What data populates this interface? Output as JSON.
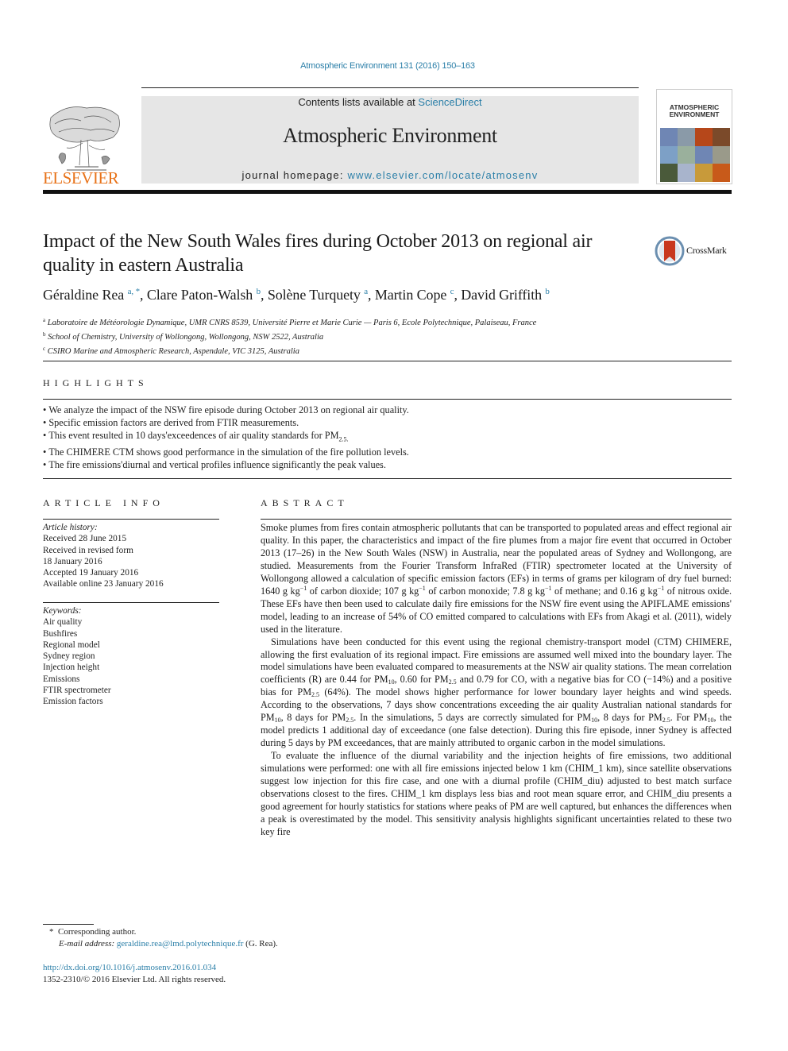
{
  "header": {
    "journal_ref": "Atmospheric Environment 131 (2016) 150–163",
    "contents_prefix": "Contents lists available at ",
    "contents_link": "ScienceDirect",
    "journal_title": "Atmospheric Environment",
    "homepage_prefix": "journal homepage: ",
    "homepage_link": "www.elsevier.com/locate/atmosenv",
    "publisher_logo": "ELSEVIER",
    "cover_title_line1": "ATMOSPHERIC",
    "cover_title_line2": "ENVIRONMENT",
    "colors": {
      "link": "#2b7fa8",
      "publisher": "#e8731a",
      "header_box": "#e6e6e6"
    }
  },
  "article": {
    "title": "Impact of the New South Wales fires during October 2013 on regional air quality in eastern Australia",
    "crossmark_label": "CrossMark",
    "authors": [
      {
        "name": "Géraldine Rea",
        "sup": "a, *"
      },
      {
        "name": "Clare Paton-Walsh",
        "sup": "b"
      },
      {
        "name": "Solène Turquety",
        "sup": "a"
      },
      {
        "name": "Martin Cope",
        "sup": "c"
      },
      {
        "name": "David Griffith",
        "sup": "b"
      }
    ],
    "affiliations": [
      {
        "key": "a",
        "text": "Laboratoire de Météorologie Dynamique, UMR CNRS 8539, Université Pierre et Marie Curie — Paris 6, Ecole Polytechnique, Palaiseau, France"
      },
      {
        "key": "b",
        "text": "School of Chemistry, University of Wollongong, Wollongong, NSW 2522, Australia"
      },
      {
        "key": "c",
        "text": "CSIRO Marine and Atmospheric Research, Aspendale, VIC 3125, Australia"
      }
    ]
  },
  "highlights": {
    "heading": "HIGHLIGHTS",
    "items": [
      "We analyze the impact of the NSW fire episode during October 2013 on regional air quality.",
      "Specific emission factors are derived from FTIR measurements.",
      "This event resulted in 10 days'exceedences of air quality standards for PM",
      "The CHIMERE CTM shows good performance in the simulation of the fire pollution levels.",
      "The fire emissions'diurnal and vertical profiles influence significantly the peak values."
    ],
    "item3_sub": "2.5."
  },
  "article_info": {
    "heading": "ARTICLE INFO",
    "history_label": "Article history:",
    "history": [
      "Received 28 June 2015",
      "Received in revised form",
      "18 January 2016",
      "Accepted 19 January 2016",
      "Available online 23 January 2016"
    ],
    "keywords_label": "Keywords:",
    "keywords": [
      "Air quality",
      "Bushfires",
      "Regional model",
      "Sydney region",
      "Injection height",
      "Emissions",
      "FTIR spectrometer",
      "Emission factors"
    ]
  },
  "abstract": {
    "heading": "ABSTRACT",
    "p1": "Smoke plumes from fires contain atmospheric pollutants that can be transported to populated areas and effect regional air quality. In this paper, the characteristics and impact of the fire plumes from a major fire event that occurred in October 2013 (17–26) in the New South Wales (NSW) in Australia, near the populated areas of Sydney and Wollongong, are studied. Measurements from the Fourier Transform InfraRed (FTIR) spectrometer located at the University of Wollongong allowed a calculation of specific emission factors (EFs) in terms of grams per kilogram of dry fuel burned: 1640 g kg{-1} of carbon dioxide; 107 g kg{-1} of carbon monoxide; 7.8 g kg{-1} of methane; and 0.16 g kg{-1} of nitrous oxide. These EFs have then been used to calculate daily fire emissions for the NSW fire event using the APIFLAME emissions' model, leading to an increase of 54% of CO emitted compared to calculations with EFs from Akagi et al. (2011), widely used in the literature.",
    "p2": "Simulations have been conducted for this event using the regional chemistry-transport model (CTM) CHIMERE, allowing the first evaluation of its regional impact. Fire emissions are assumed well mixed into the boundary layer. The model simulations have been evaluated compared to measurements at the NSW air quality stations. The mean correlation coefficients (R) are 0.44 for PM[10], 0.60 for PM[2.5] and 0.79 for CO, with a negative bias for CO (−14%) and a positive bias for PM[2.5] (64%). The model shows higher performance for lower boundary layer heights and wind speeds. According to the observations, 7 days show concentrations exceeding the air quality Australian national standards for PM[10], 8 days for PM[2.5]. In the simulations, 5 days are correctly simulated for PM[10], 8 days for PM[2.5]. For PM[10], the model predicts 1 additional day of exceedance (one false detection). During this fire episode, inner Sydney is affected during 5 days by PM exceedances, that are mainly attributed to organic carbon in the model simulations.",
    "p3": "To evaluate the influence of the diurnal variability and the injection heights of fire emissions, two additional simulations were performed: one with all fire emissions injected below 1 km (CHIM_1 km), since satellite observations suggest low injection for this fire case, and one with a diurnal profile (CHIM_diu) adjusted to best match surface observations closest to the fires. CHIM_1 km displays less bias and root mean square error, and CHIM_diu presents a good agreement for hourly statistics for stations where peaks of PM are well captured, but enhances the differences when a peak is overestimated by the model. This sensitivity analysis highlights significant uncertainties related to these two key fire"
  },
  "footnotes": {
    "corresponding_mark": "*",
    "corresponding_text": "Corresponding author.",
    "email_label": "E-mail address:",
    "email": "geraldine.rea@lmd.polytechnique.fr",
    "email_suffix": "(G. Rea).",
    "doi": "http://dx.doi.org/10.1016/j.atmosenv.2016.01.034",
    "copyright": "1352-2310/© 2016 Elsevier Ltd. All rights reserved."
  }
}
